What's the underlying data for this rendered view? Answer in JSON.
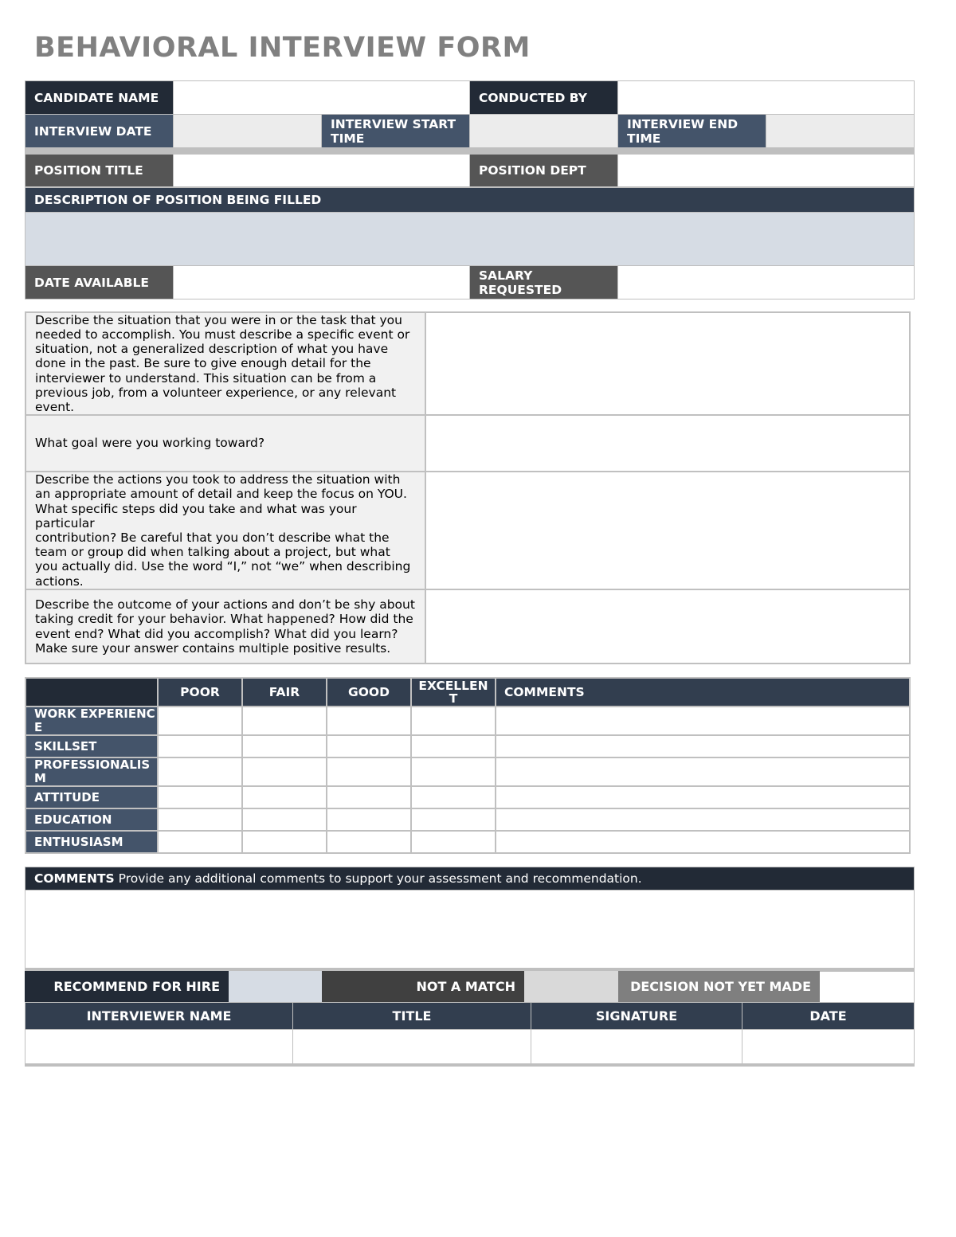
{
  "header": {
    "title": "BEHAVIORAL INTERVIEW FORM"
  },
  "info": {
    "candidate_name": "CANDIDATE NAME",
    "conducted_by": "CONDUCTED BY",
    "interview_date": "INTERVIEW DATE",
    "interview_start_time": "INTERVIEW START TIME",
    "interview_end_time": "INTERVIEW END TIME",
    "position_title": "POSITION TITLE",
    "position_dept": "POSITION DEPT",
    "description_header": "DESCRIPTION OF POSITION BEING FILLED",
    "date_available": "DATE AVAILABLE",
    "salary_requested": "SALARY REQUESTED"
  },
  "questions": [
    {
      "prompt": "Describe the situation that you were in or the task that you needed to accomplish. You must describe a specific event or situation, not a generalized description of what you have done in the past. Be sure to give enough detail for the interviewer to understand. This situation can be from a previous job, from a volunteer experience, or any relevant event.",
      "answer": ""
    },
    {
      "prompt": "What goal were you working toward?",
      "answer": ""
    },
    {
      "prompt": "Describe the actions you took to address the situation with an appropriate amount of detail and keep the focus on YOU. What specific steps did you take and what was your particular\ncontribution? Be careful that you don’t describe what the team or group did when talking about a project, but what you actually did. Use the word “I,” not “we” when describing actions.",
      "answer": ""
    },
    {
      "prompt": "Describe the outcome of your actions and don’t be shy about taking credit for your behavior. What happened? How did the event end? What did you accomplish? What did you learn? Make sure your answer contains multiple positive results.",
      "answer": ""
    }
  ],
  "rating": {
    "columns": [
      "POOR",
      "FAIR",
      "GOOD",
      "EXCELLENT",
      "COMMENTS"
    ],
    "rows": [
      "WORK EXPERIENCE",
      "SKILLSET",
      "PROFESSIONALISM",
      "ATTITUDE",
      "EDUCATION",
      "ENTHUSIASM"
    ]
  },
  "comments": {
    "label": "COMMENTS",
    "hint": "Provide any additional comments to support your assessment and recommendation."
  },
  "decision": {
    "recommend": "RECOMMEND FOR HIRE",
    "not_match": "NOT A MATCH",
    "undecided": "DECISION NOT YET MADE"
  },
  "signoff": {
    "columns": [
      "INTERVIEWER NAME",
      "TITLE",
      "SIGNATURE",
      "DATE"
    ]
  }
}
